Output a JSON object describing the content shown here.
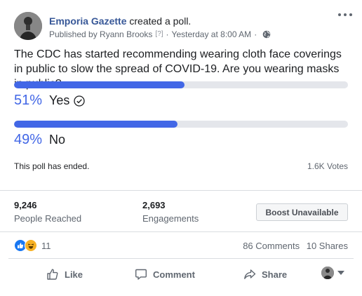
{
  "post": {
    "page_name": "Emporia Gazette",
    "action_text": "created a poll.",
    "published_by": "Published by Ryann Brooks",
    "help_marker": "[?]",
    "timestamp": "Yesterday at 8:00 AM",
    "separator": "·"
  },
  "poll": {
    "question": "The CDC has started recommending wearing cloth face coverings in public to slow the spread of COVID-19. Are you wearing masks in public?",
    "options": [
      {
        "percent_label": "51%",
        "label": "Yes",
        "fraction": 0.51,
        "selected": true
      },
      {
        "percent_label": "49%",
        "label": "No",
        "fraction": 0.49,
        "selected": false
      }
    ],
    "status": "This poll has ended.",
    "votes": "1.6K Votes"
  },
  "insights": {
    "reach_value": "9,246",
    "reach_label": "People Reached",
    "engagement_value": "2,693",
    "engagement_label": "Engagements",
    "boost_label": "Boost Unavailable"
  },
  "reactions": {
    "count": "11",
    "types": [
      "like-icon",
      "haha-icon"
    ],
    "comments": "86 Comments",
    "shares": "10 Shares"
  },
  "actions": {
    "like": "Like",
    "comment": "Comment",
    "share": "Share"
  },
  "colors": {
    "accent": "#4267e6",
    "link": "#385898",
    "like_blue": "#1877f2"
  }
}
